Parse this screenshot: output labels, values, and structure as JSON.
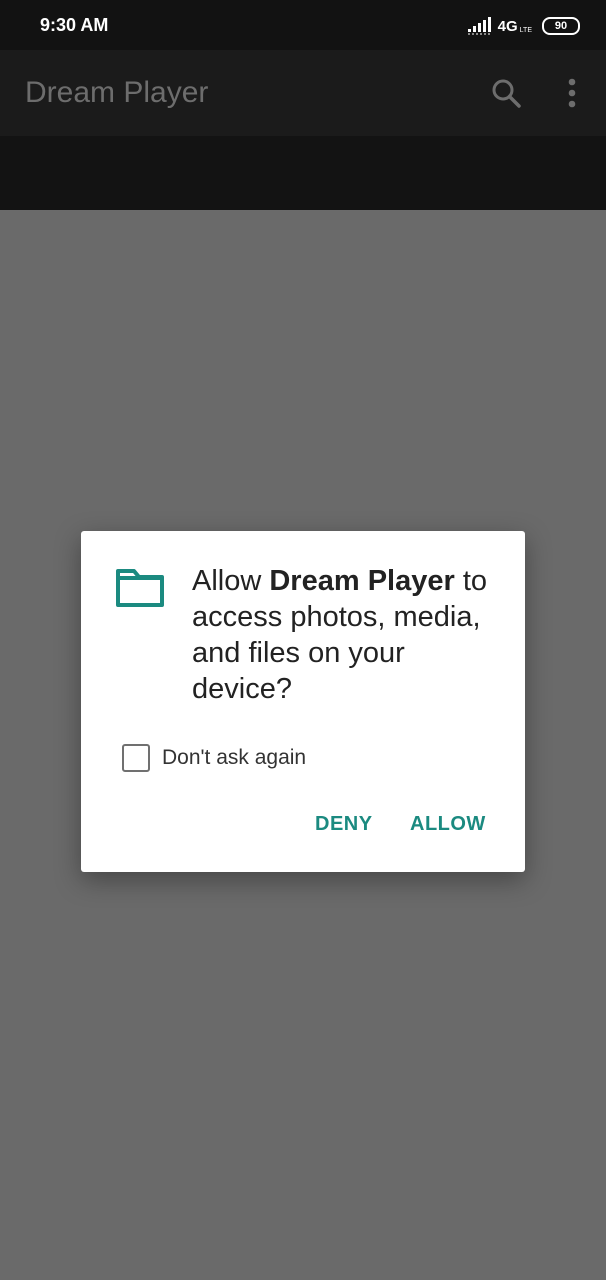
{
  "status_bar": {
    "time": "9:30 AM",
    "network": "4G",
    "network_sub": "LTE",
    "battery": "90"
  },
  "app_bar": {
    "title": "Dream Player",
    "search_icon": "search-icon",
    "more_icon": "more-vert-icon"
  },
  "dialog": {
    "icon": "folder-icon",
    "message_prefix": "Allow ",
    "app_name": "Dream Player",
    "message_suffix": " to access photos, media, and files on your device?",
    "checkbox_label": "Don't ask again",
    "checkbox_checked": false,
    "deny_label": "DENY",
    "allow_label": "ALLOW",
    "accent_color": "#1b8a80"
  },
  "colors": {
    "status_bar": "#121212",
    "app_bar": "#1b1b1b",
    "scrim": "#6a6a6a",
    "dialog": "#ffffff"
  }
}
